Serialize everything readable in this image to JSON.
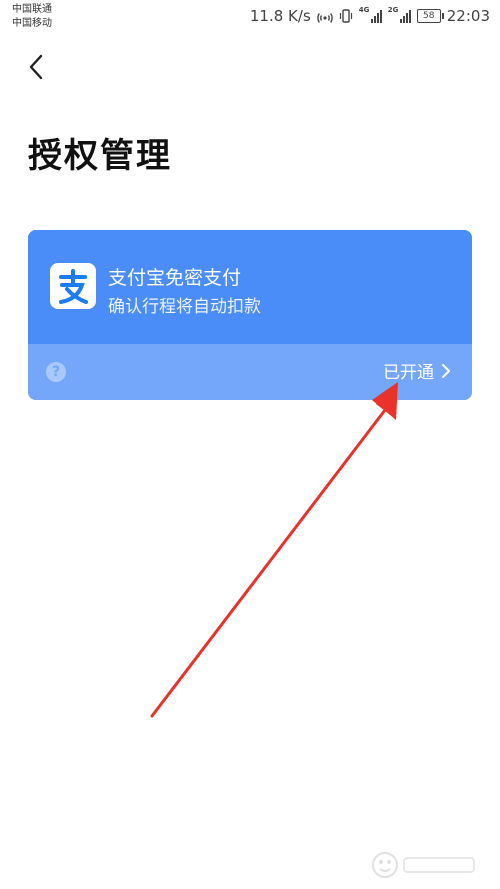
{
  "status_bar": {
    "carrier1": "中国联通",
    "carrier2": "中国移动",
    "speed": "11.8 K/s",
    "sig1_tag": "4G",
    "sig2_tag": "2G",
    "battery": "58",
    "time": "22:03"
  },
  "page": {
    "title": "授权管理"
  },
  "card": {
    "app_icon": "alipay-icon",
    "title": "支付宝免密支付",
    "subtitle": "确认行程将自动扣款",
    "status": "已开通",
    "colors": {
      "primary": "#4a8df8",
      "footer": "#74a6fa"
    }
  },
  "annotation": {
    "arrow_color": "#e8322a"
  }
}
